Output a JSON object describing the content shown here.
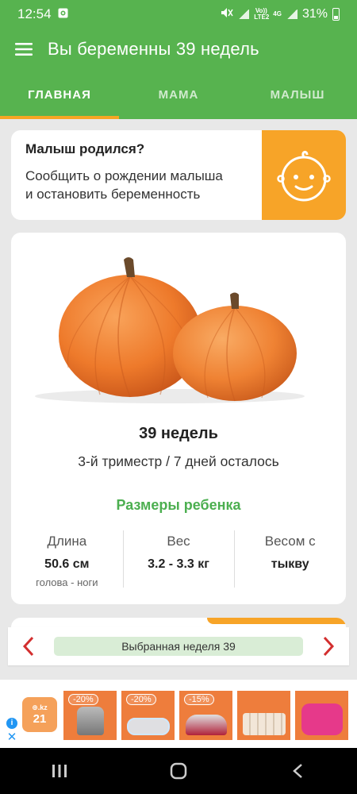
{
  "status_bar": {
    "time": "12:54",
    "volte": "Vo)) LTE2",
    "network": "4G",
    "battery": "31%"
  },
  "app_bar": {
    "title": "Вы беременны 39 недель"
  },
  "tabs": [
    {
      "label": "ГЛАВНАЯ",
      "active": true
    },
    {
      "label": "МАМА",
      "active": false
    },
    {
      "label": "МАЛЫШ",
      "active": false
    }
  ],
  "born_card": {
    "title": "Малыш родился?",
    "desc_line1": "Сообщить о рождении малыша",
    "desc_line2": "и остановить беременность",
    "icon": "baby-face-icon"
  },
  "main_card": {
    "image": "pumpkins",
    "weeks": "39 недель",
    "trimester": "3-й триместр / 7 дней осталось",
    "sizes_title": "Размеры ребенка",
    "stats": [
      {
        "label": "Длина",
        "value": "50.6 см",
        "note": "голова - ноги"
      },
      {
        "label": "Вес",
        "value": "3.2 - 3.3 кг",
        "note": ""
      },
      {
        "label": "Весом с",
        "value": "тыкву",
        "note": ""
      }
    ]
  },
  "week_selector": {
    "label": "Выбранная неделя 39"
  },
  "ad": {
    "logo_top": "⊕.kz",
    "logo_num": "21",
    "products": [
      {
        "discount": "-20%",
        "item": "meat-grinder"
      },
      {
        "discount": "-20%",
        "item": "glass-dish"
      },
      {
        "discount": "-15%",
        "item": "steam-iron"
      },
      {
        "discount": "",
        "item": "dish-set"
      },
      {
        "discount": "",
        "item": "smart-speaker"
      }
    ]
  },
  "colors": {
    "brand_green": "#57b34f",
    "accent_orange": "#f7a428",
    "text_green": "#4caf50",
    "arrow_red": "#d32f2f"
  }
}
